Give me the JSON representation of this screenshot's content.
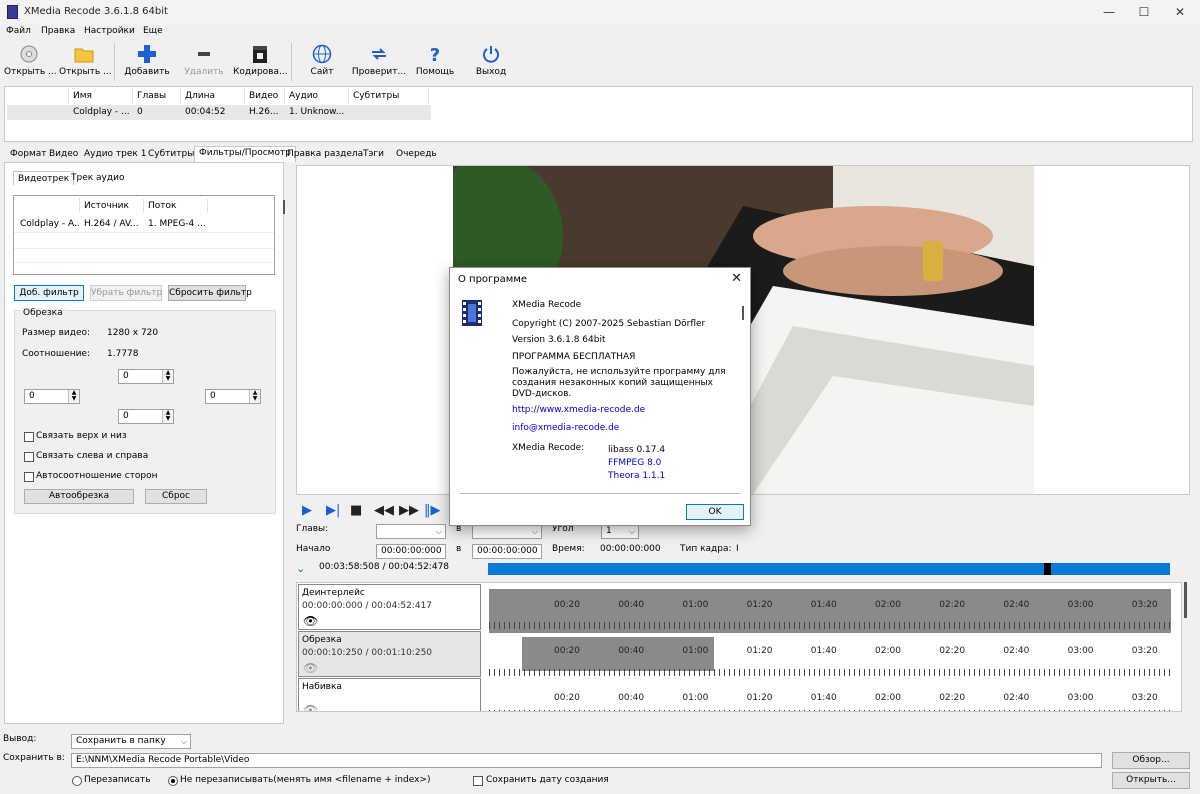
{
  "window": {
    "title": "XMedia Recode 3.6.1.8 64bit",
    "controls": {
      "minimize": "—",
      "maximize": "☐",
      "close": "✕"
    }
  },
  "menu": [
    "Файл",
    "Правка",
    "Настройки",
    "Еще"
  ],
  "toolbar": [
    {
      "label": "Открыть ...",
      "icon": "disc-open-icon"
    },
    {
      "label": "Открыть ...",
      "icon": "folder-open-icon"
    },
    {
      "label": "Добавить",
      "icon": "plus-icon"
    },
    {
      "label": "Удалить",
      "icon": "minus-icon",
      "disabled": true
    },
    {
      "label": "Кодирова...",
      "icon": "film-clapper-icon"
    },
    {
      "label": "Сайт",
      "icon": "globe-icon"
    },
    {
      "label": "Проверит...",
      "icon": "refresh-arrows-icon"
    },
    {
      "label": "Помощь",
      "icon": "question-icon"
    },
    {
      "label": "Выход",
      "icon": "power-icon"
    }
  ],
  "file_list": {
    "columns": [
      "Имя",
      "Главы",
      "Длина",
      "Видео",
      "Аудио",
      "Субтитры"
    ],
    "rows": [
      [
        "Coldplay - ...",
        "0",
        "00:04:52",
        "H.26...",
        "1. Unknow...",
        ""
      ]
    ]
  },
  "tabs": [
    "Формат",
    "Видео",
    "Аудио трек 1",
    "Субтитры",
    "Фильтры/Просмотр",
    "Правка раздела",
    "Тэги",
    "Очередь"
  ],
  "active_tab": "Фильтры/Просмотр",
  "subtabs": [
    "Видеотрек",
    "Трек аудио"
  ],
  "stream_table": {
    "columns": [
      "Источник",
      "Поток"
    ],
    "row": [
      "Coldplay - A...",
      "H.264 / AV...",
      "1. MPEG-4 ..."
    ]
  },
  "filter_buttons": {
    "add": "Доб. фильтр",
    "remove": "Убрать фильтр",
    "reset": "Сбросить фильтр"
  },
  "crop": {
    "title": "Обрезка",
    "size_label": "Размер видео:",
    "size_value": "1280 x 720",
    "ratio_label": "Соотношение:",
    "ratio_value": "1.7778",
    "top": "0",
    "left": "0",
    "right": "0",
    "bottom": "0",
    "link_tb": "Связать верх и низ",
    "link_lr": "Связать слева и справа",
    "keep_ratio": "Автосоотношение сторон",
    "autocrop": "Автообрезка",
    "reset": "Сброс"
  },
  "playback": {
    "chapters_label": "Главы:",
    "in_label": "в",
    "angle_label": "Угол",
    "angle_value": "1",
    "start_label": "Начало",
    "start_value": "00:00:00:000",
    "end_value": "00:00:00:000",
    "time_label": "Время:",
    "time_value": "00:00:00:000",
    "frame_label": "Тип кадра:",
    "frame_value": "I",
    "position": "00:03:58:508 / 00:04:52:478",
    "playhead_fraction": 0.815
  },
  "timeline": {
    "ticks": [
      "00:20",
      "00:40",
      "01:00",
      "01:20",
      "01:40",
      "02:00",
      "02:20",
      "02:40",
      "03:00",
      "03:20"
    ],
    "tracks": [
      {
        "name": "Деинтерлейс",
        "time": "00:00:00:000 / 00:04:52:417"
      },
      {
        "name": "Обрезка",
        "time": "00:00:10:250 / 00:01:10:250"
      },
      {
        "name": "Набивка",
        "time": ""
      }
    ]
  },
  "about": {
    "title": "О программе",
    "app": "XMedia Recode",
    "copyright": "Copyright (C) 2007-2025  Sebastian Dörfler",
    "version": "Version 3.6.1.8 64bit",
    "free": "ПРОГРАММА БЕСПЛАТНАЯ",
    "notice1": "Пожалуйста, не используйте программу для",
    "notice2": "создания незаконных копий защищенных",
    "notice3": "DVD-дисков.",
    "url": "http://www.xmedia-recode.de",
    "email": "info@xmedia-recode.de",
    "libs_label": "XMedia Recode:",
    "lib1": "libass 0.17.4",
    "lib2": "FFMPEG 8.0",
    "lib3": "Theora 1.1.1",
    "ok": "OK"
  },
  "output": {
    "output_label": "Вывод:",
    "output_value": "Сохранить в папку",
    "save_label": "Сохранить в:",
    "save_path": "E:\\NNM\\XMedia Recode Portable\\Video",
    "browse": "Обзор...",
    "open": "Открыть...",
    "overwrite": "Перезаписать",
    "no_overwrite": "Не перезаписывать(менять имя <filename + index>)",
    "keep_date": "Сохранить дату создания"
  }
}
